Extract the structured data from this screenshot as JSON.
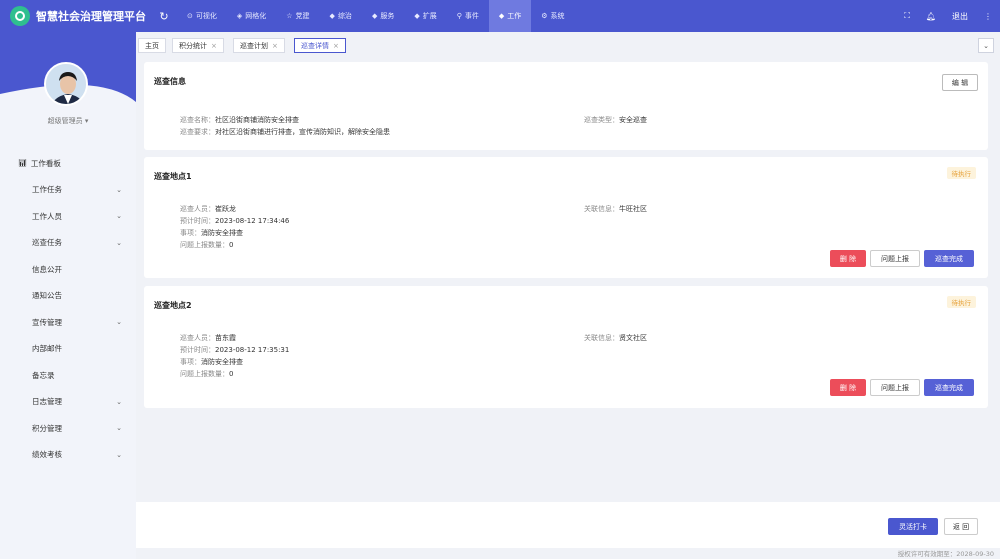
{
  "app": {
    "title": "智慧社会治理管理平台",
    "refresh_icon": "refresh-icon"
  },
  "menu": [
    {
      "label": "可视化",
      "icon": "clock-icon",
      "glyph": "⊙",
      "active": false
    },
    {
      "label": "网格化",
      "icon": "grid-icon",
      "glyph": "◈",
      "active": false
    },
    {
      "label": "党建",
      "icon": "star-icon",
      "glyph": "☆",
      "active": false
    },
    {
      "label": "综治",
      "icon": "shield-icon",
      "glyph": "◆",
      "active": false
    },
    {
      "label": "服务",
      "icon": "service-icon",
      "glyph": "◆",
      "active": false
    },
    {
      "label": "扩展",
      "icon": "extension-icon",
      "glyph": "◆",
      "active": false
    },
    {
      "label": "事件",
      "icon": "location-icon",
      "glyph": "⚲",
      "active": false
    },
    {
      "label": "工作",
      "icon": "work-icon",
      "glyph": "◆",
      "active": true
    },
    {
      "label": "系统",
      "icon": "gear-icon",
      "glyph": "⚙",
      "active": false
    }
  ],
  "top_right": {
    "fullscreen_icon": "fullscreen-icon",
    "bell_icon": "bell-icon",
    "logout_label": "退出",
    "more_icon": "more-vertical-icon"
  },
  "sidebar": {
    "user_label": "超级管理员 ▾",
    "items": [
      {
        "label": "工作看板",
        "root": true,
        "has_children": false
      },
      {
        "label": "工作任务",
        "root": false,
        "has_children": true
      },
      {
        "label": "工作人员",
        "root": false,
        "has_children": true
      },
      {
        "label": "巡查任务",
        "root": false,
        "has_children": true
      },
      {
        "label": "信息公开",
        "root": false,
        "has_children": false
      },
      {
        "label": "通知公告",
        "root": false,
        "has_children": false
      },
      {
        "label": "宣传管理",
        "root": false,
        "has_children": true
      },
      {
        "label": "内部邮件",
        "root": false,
        "has_children": false
      },
      {
        "label": "备忘录",
        "root": false,
        "has_children": false
      },
      {
        "label": "日志管理",
        "root": false,
        "has_children": true
      },
      {
        "label": "积分管理",
        "root": false,
        "has_children": true
      },
      {
        "label": "绩效考核",
        "root": false,
        "has_children": true
      }
    ]
  },
  "tabs": [
    {
      "label": "主页",
      "closable": false,
      "active": false
    },
    {
      "label": "积分统计",
      "closable": true,
      "active": false
    },
    {
      "label": "巡查计划",
      "closable": true,
      "active": false
    },
    {
      "label": "巡查详情",
      "closable": true,
      "active": true
    }
  ],
  "info_card": {
    "title": "巡查信息",
    "edit_label": "编 辑",
    "name_label": "巡查名称：",
    "name_value": "社区沿街商铺消防安全排查",
    "type_label": "巡查类型：",
    "type_value": "安全巡查",
    "req_label": "巡查要求：",
    "req_value": "对社区沿街商铺进行排查，宣传消防知识，解除安全隐患"
  },
  "points": [
    {
      "title": "巡查地点1",
      "status": "待执行",
      "person_label": "巡查人员：",
      "person": "崔跃龙",
      "time_label": "预计时间：",
      "time": "2023-08-12 17:34:46",
      "matter_label": "事项：",
      "matter": "消防安全排查",
      "count_label": "问题上报数量：",
      "count": "0",
      "relation_label": "关联信息：",
      "relation": "牛旺社区",
      "delete_label": "删 除",
      "report_label": "问题上报",
      "done_label": "巡查完成"
    },
    {
      "title": "巡查地点2",
      "status": "待执行",
      "person_label": "巡查人员：",
      "person": "苗东霞",
      "time_label": "预计时间：",
      "time": "2023-08-12 17:35:31",
      "matter_label": "事项：",
      "matter": "消防安全排查",
      "count_label": "问题上报数量：",
      "count": "0",
      "relation_label": "关联信息：",
      "relation": "贤文社区",
      "delete_label": "删 除",
      "report_label": "问题上报",
      "done_label": "巡查完成"
    }
  ],
  "footer": {
    "checkin_label": "灵活打卡",
    "back_label": "返 回",
    "license": "授权许可有效期至：2028-09-30"
  }
}
